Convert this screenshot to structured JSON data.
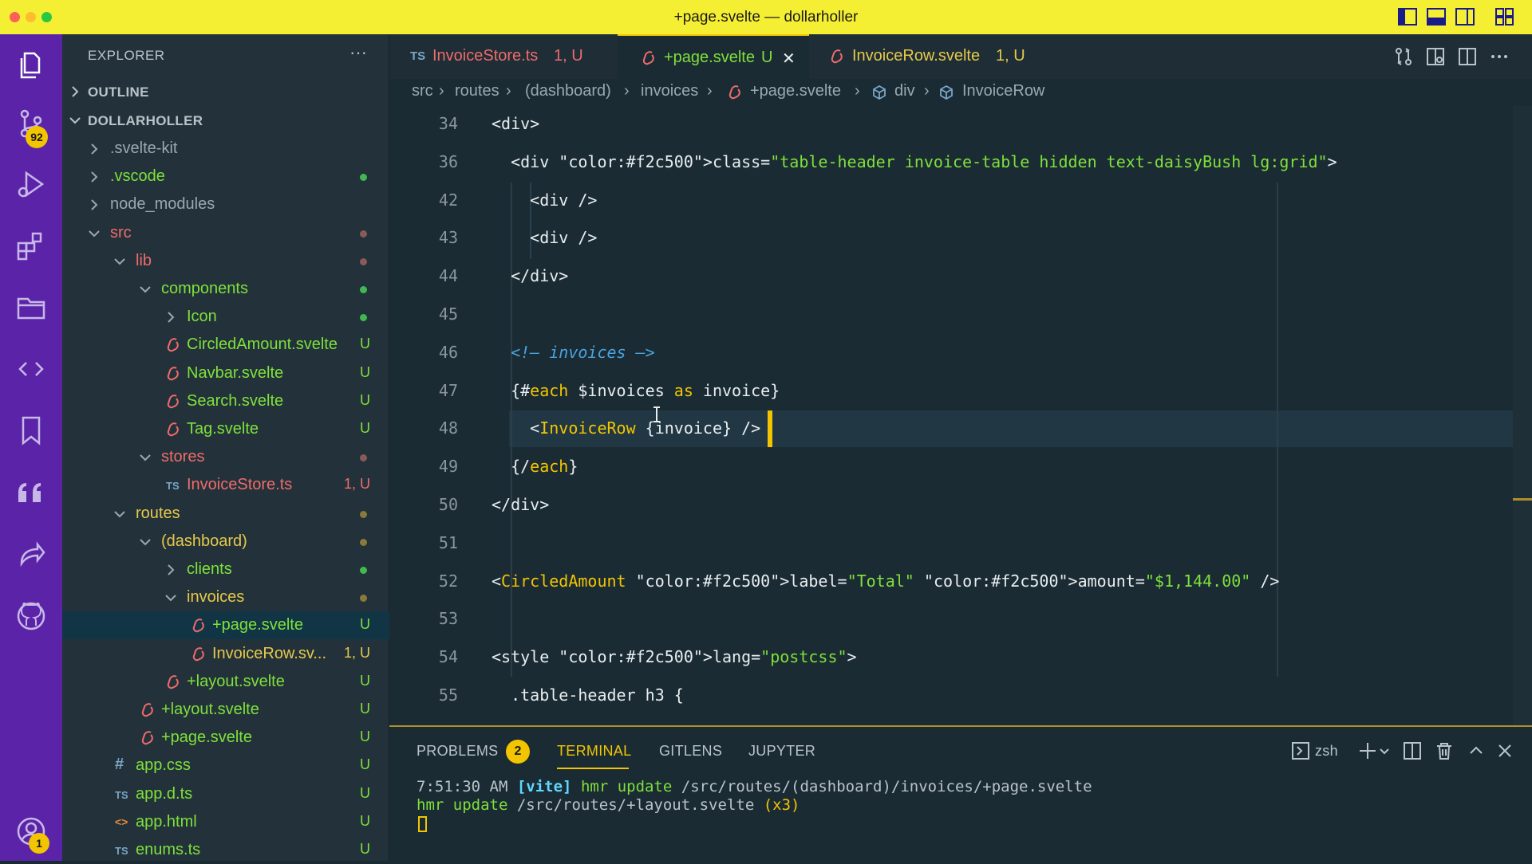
{
  "window": {
    "title": "+page.svelte — dollarholler"
  },
  "activity": {
    "source_control_badge": "92",
    "accounts_badge": "1"
  },
  "explorer": {
    "title": "EXPLORER",
    "more": "···",
    "outline_label": "OUTLINE",
    "project_label": "DOLLARHOLLER"
  },
  "tree": [
    {
      "name": ".svelte-kit",
      "status": "",
      "dot": "",
      "color": "#9aa8b0"
    },
    {
      "name": ".vscode",
      "status": "",
      "dot": "#3fb950",
      "color": "#7ee03b"
    },
    {
      "name": "node_modules",
      "status": "",
      "dot": "",
      "color": "#9aa8b0"
    },
    {
      "name": "src",
      "status": "",
      "dot": "#8a5a5a",
      "color": "#f06b6b"
    },
    {
      "name": "lib",
      "status": "",
      "dot": "#8a5a5a",
      "color": "#f06b6b"
    },
    {
      "name": "components",
      "status": "",
      "dot": "#3fb950",
      "color": "#7ee03b"
    },
    {
      "name": "Icon",
      "status": "",
      "dot": "#3fb950",
      "color": "#7ee03b"
    },
    {
      "name": "CircledAmount.svelte",
      "status": "U",
      "dot": "",
      "color": "#7ee03b"
    },
    {
      "name": "Navbar.svelte",
      "status": "U",
      "dot": "",
      "color": "#7ee03b"
    },
    {
      "name": "Search.svelte",
      "status": "U",
      "dot": "",
      "color": "#7ee03b"
    },
    {
      "name": "Tag.svelte",
      "status": "U",
      "dot": "",
      "color": "#7ee03b"
    },
    {
      "name": "stores",
      "status": "",
      "dot": "#8a5a5a",
      "color": "#f06b6b"
    },
    {
      "name": "InvoiceStore.ts",
      "status": "1, U",
      "dot": "",
      "color": "#f06b6b"
    },
    {
      "name": "routes",
      "status": "",
      "dot": "#8a7a3a",
      "color": "#e6c94a"
    },
    {
      "name": "(dashboard)",
      "status": "",
      "dot": "#8a7a3a",
      "color": "#e6c94a"
    },
    {
      "name": "clients",
      "status": "",
      "dot": "#3fb950",
      "color": "#7ee03b"
    },
    {
      "name": "invoices",
      "status": "",
      "dot": "#8a7a3a",
      "color": "#e6c94a"
    },
    {
      "name": "+page.svelte",
      "status": "U",
      "dot": "",
      "color": "#7ee03b"
    },
    {
      "name": "InvoiceRow.sv...",
      "status": "1, U",
      "dot": "",
      "color": "#e6c94a"
    },
    {
      "name": "+layout.svelte",
      "status": "U",
      "dot": "",
      "color": "#7ee03b"
    },
    {
      "name": "+layout.svelte",
      "status": "U",
      "dot": "",
      "color": "#7ee03b"
    },
    {
      "name": "+page.svelte",
      "status": "U",
      "dot": "",
      "color": "#7ee03b"
    },
    {
      "name": "app.css",
      "status": "U",
      "dot": "",
      "color": "#7ee03b"
    },
    {
      "name": "app.d.ts",
      "status": "U",
      "dot": "",
      "color": "#7ee03b"
    },
    {
      "name": "app.html",
      "status": "U",
      "dot": "",
      "color": "#7ee03b"
    },
    {
      "name": "enums.ts",
      "status": "U",
      "dot": "",
      "color": "#7ee03b"
    }
  ],
  "tabs": [
    {
      "prefix": "TS",
      "name": "InvoiceStore.ts",
      "status": "1, U"
    },
    {
      "name": "+page.svelte",
      "status": "U",
      "close": "✕"
    },
    {
      "name": "InvoiceRow.svelte",
      "status": "1, U"
    }
  ],
  "breadcrumb": [
    "src",
    "routes",
    "(dashboard)",
    "invoices",
    "+page.svelte",
    "div",
    "InvoiceRow"
  ],
  "code": [
    {
      "n": "34",
      "t": "<div>"
    },
    {
      "n": "36",
      "t": "  <div class=\"table-header invoice-table hidden text-daisyBush lg:grid\">"
    },
    {
      "n": "42",
      "t": "    <div />"
    },
    {
      "n": "43",
      "t": "    <div />"
    },
    {
      "n": "44",
      "t": "  </div>"
    },
    {
      "n": "45",
      "t": ""
    },
    {
      "n": "46",
      "t": "  <!— invoices —>"
    },
    {
      "n": "47",
      "t": "  {#each $invoices as invoice}"
    },
    {
      "n": "48",
      "t": "    <InvoiceRow {invoice} />"
    },
    {
      "n": "49",
      "t": "  {/each}"
    },
    {
      "n": "50",
      "t": "</div>"
    },
    {
      "n": "51",
      "t": ""
    },
    {
      "n": "52",
      "t": "<CircledAmount label=\"Total\" amount=\"$1,144.00\" />"
    },
    {
      "n": "53",
      "t": ""
    },
    {
      "n": "54",
      "t": "<style lang=\"postcss\">"
    },
    {
      "n": "55",
      "t": "  .table-header h3 {"
    }
  ],
  "panel": {
    "tabs": [
      "PROBLEMS",
      "TERMINAL",
      "GITLENS",
      "JUPYTER"
    ],
    "problems_count": "2",
    "shell": "zsh",
    "terminal_lines": [
      {
        "time": "7:51:30 AM",
        "tag": "[vite]",
        "msg": "hmr update",
        "path": "/src/routes/(dashboard)/invoices/+page.svelte",
        "suffix": ""
      },
      {
        "time": "",
        "tag": "",
        "msg": "hmr update",
        "path": "/src/routes/+layout.svelte",
        "suffix": "(x3)"
      }
    ]
  }
}
